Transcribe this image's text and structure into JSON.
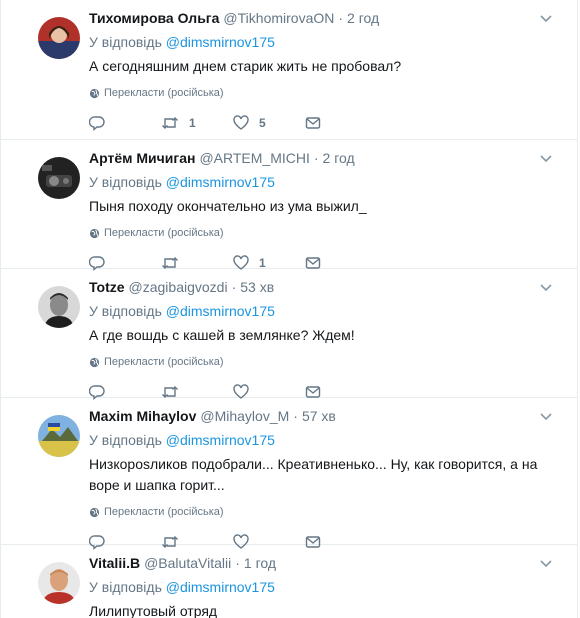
{
  "translate_label": "Перекласти (російська)",
  "reply_prefix": "У відповідь",
  "tweets": [
    {
      "name": "Тихомирова Ольга",
      "handle": "@TikhomirovaON",
      "time": "2 год",
      "reply_to": "@dimsmirnov175",
      "text": "А сегодняшним днем старик жить не пробовал?",
      "retweets": "1",
      "likes": "5"
    },
    {
      "name": "Артём Мичиган",
      "handle": "@ARTEM_MICHI",
      "time": "2 год",
      "reply_to": "@dimsmirnov175",
      "text": "Пыня походу окончательно из ума выжил_",
      "retweets": "",
      "likes": "1"
    },
    {
      "name": "Totze",
      "handle": "@zagibaigvozdi",
      "time": "53 хв",
      "reply_to": "@dimsmirnov175",
      "text": "А где вошдь с кашей в землянке? Ждем!",
      "retweets": "",
      "likes": ""
    },
    {
      "name": "Maxim Mihaylov",
      "handle": "@Mihaylov_M",
      "time": "57 хв",
      "reply_to": "@dimsmirnov175",
      "text": "Низкорosликов подобрали... Креативненько... Ну, как говорится, а на воре и шапка горит...",
      "retweets": "",
      "likes": ""
    },
    {
      "name": "Vitalii.B",
      "handle": "@BalutaVitalii",
      "time": "1 год",
      "reply_to": "@dimsmirnov175",
      "text": "Лилипутовый отряд",
      "retweets": "",
      "likes": ""
    }
  ]
}
